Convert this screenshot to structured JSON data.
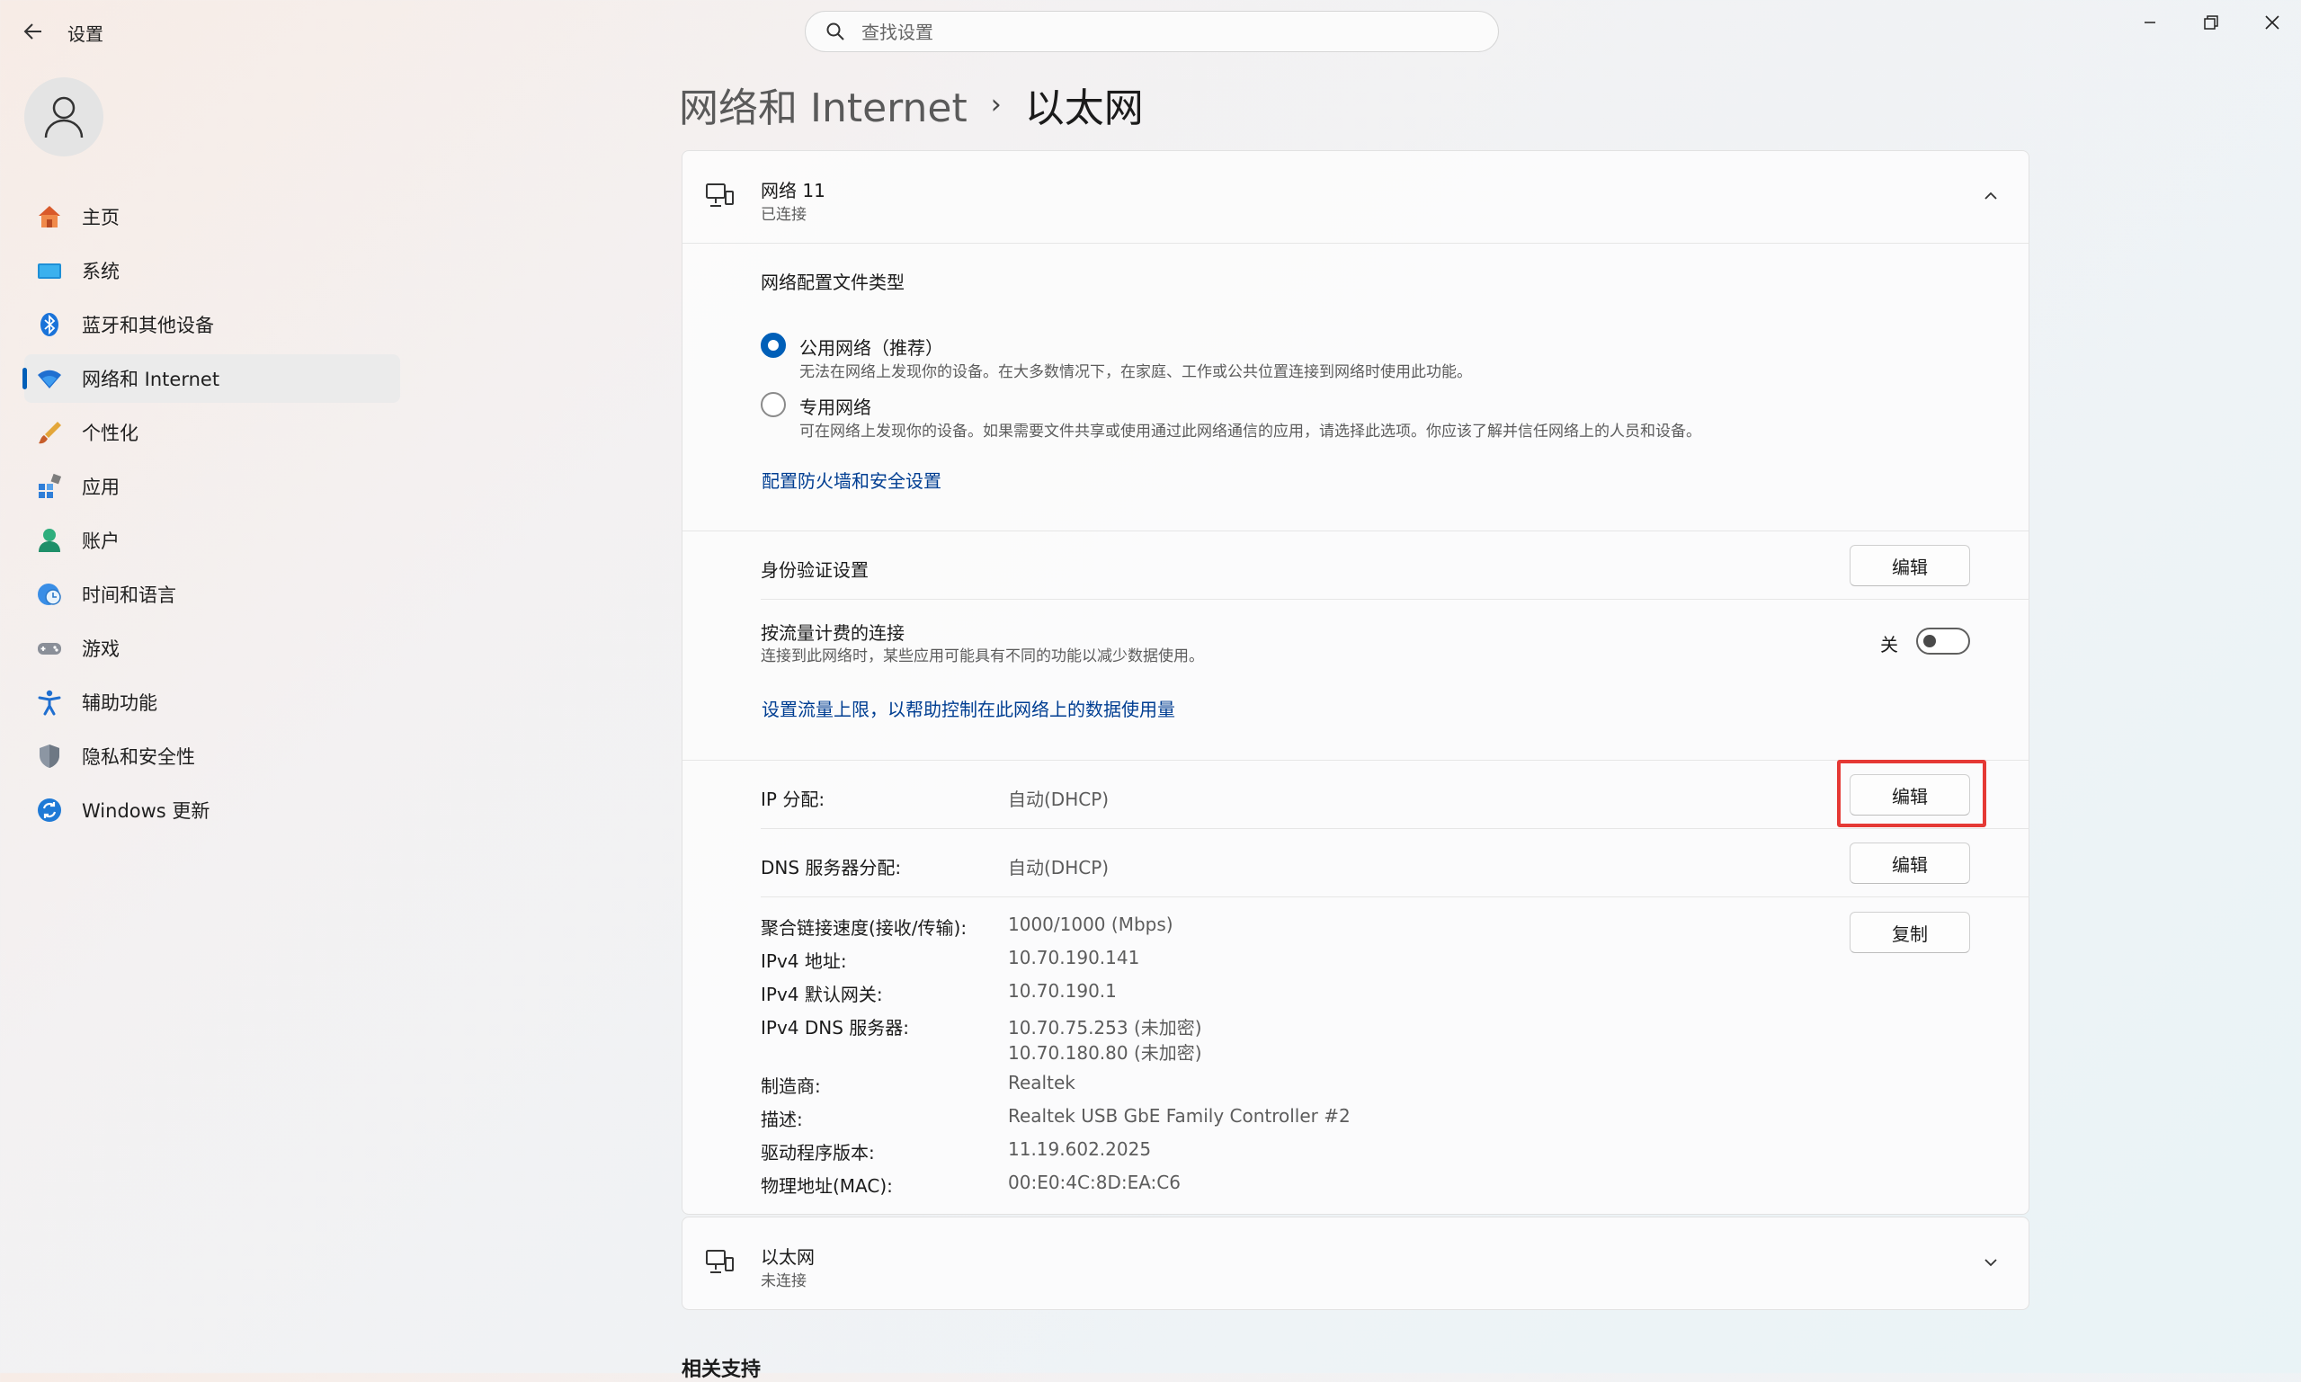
{
  "window": {
    "back_icon": "arrow-left-icon",
    "title": "设置",
    "search_placeholder": "查找设置"
  },
  "sidebar": {
    "items": [
      {
        "label": "主页",
        "icon": "home-icon"
      },
      {
        "label": "系统",
        "icon": "system-icon"
      },
      {
        "label": "蓝牙和其他设备",
        "icon": "bluetooth-icon"
      },
      {
        "label": "网络和 Internet",
        "icon": "wifi-icon",
        "active": true
      },
      {
        "label": "个性化",
        "icon": "brush-icon"
      },
      {
        "label": "应用",
        "icon": "apps-icon"
      },
      {
        "label": "账户",
        "icon": "account-icon"
      },
      {
        "label": "时间和语言",
        "icon": "globe-clock-icon"
      },
      {
        "label": "游戏",
        "icon": "gamepad-icon"
      },
      {
        "label": "辅助功能",
        "icon": "accessibility-icon"
      },
      {
        "label": "隐私和安全性",
        "icon": "shield-icon"
      },
      {
        "label": "Windows 更新",
        "icon": "update-icon"
      }
    ]
  },
  "breadcrumb": {
    "parent": "网络和 Internet",
    "separator": "›",
    "current": "以太网"
  },
  "network_card": {
    "name": "网络 11",
    "status": "已连接",
    "profile_heading": "网络配置文件类型",
    "public_title": "公用网络（推荐）",
    "public_desc": "无法在网络上发现你的设备。在大多数情况下，在家庭、工作或公共位置连接到网络时使用此功能。",
    "private_title": "专用网络",
    "private_desc": "可在网络上发现你的设备。如果需要文件共享或使用通过此网络通信的应用，请选择此选项。你应该了解并信任网络上的人员和设备。",
    "selected_profile": "public",
    "firewall_link": "配置防火墙和安全设置",
    "auth_label": "身份验证设置",
    "auth_button": "编辑",
    "metered_title": "按流量计费的连接",
    "metered_desc": "连接到此网络时，某些应用可能具有不同的功能以减少数据使用。",
    "metered_state": "关",
    "data_limit_link": "设置流量上限，以帮助控制在此网络上的数据使用量",
    "ip_label": "IP 分配:",
    "ip_value": "自动(DHCP)",
    "ip_button": "编辑",
    "dns_label": "DNS 服务器分配:",
    "dns_value": "自动(DHCP)",
    "dns_button": "编辑",
    "copy_button": "复制",
    "properties": [
      {
        "label": "聚合链接速度(接收/传输):",
        "value": "1000/1000 (Mbps)"
      },
      {
        "label": "IPv4 地址:",
        "value": "10.70.190.141"
      },
      {
        "label": "IPv4 默认网关:",
        "value": "10.70.190.1"
      },
      {
        "label": "IPv4 DNS 服务器:",
        "value": "10.70.75.253 (未加密)",
        "value2": "10.70.180.80 (未加密)"
      },
      {
        "label": "制造商:",
        "value": "Realtek"
      },
      {
        "label": "描述:",
        "value": "Realtek USB GbE Family Controller #2"
      },
      {
        "label": "驱动程序版本:",
        "value": "11.19.602.2025"
      },
      {
        "label": "物理地址(MAC):",
        "value": "00:E0:4C:8D:EA:C6"
      }
    ]
  },
  "ethernet_card": {
    "name": "以太网",
    "status": "未连接"
  },
  "related_heading": "相关支持",
  "colors": {
    "accent": "#005fb8",
    "link": "#003e92",
    "highlight": "#e53935"
  }
}
